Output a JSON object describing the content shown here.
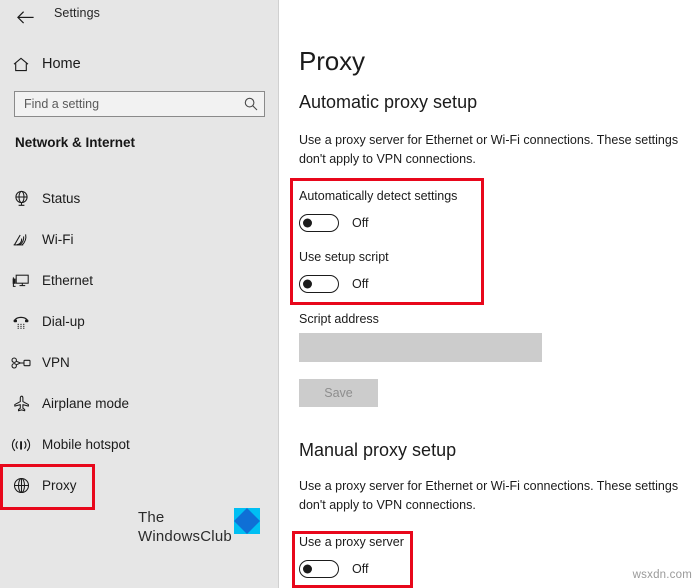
{
  "window": {
    "title": "Settings",
    "back_icon": "back-arrow-icon"
  },
  "sidebar": {
    "home": {
      "label": "Home",
      "icon": "home-icon"
    },
    "search": {
      "value": "",
      "placeholder": "Find a setting",
      "icon": "search-icon"
    },
    "category_heading": "Network & Internet",
    "items": [
      {
        "label": "Status",
        "icon": "status-globe-icon",
        "selected": false
      },
      {
        "label": "Wi-Fi",
        "icon": "wifi-icon",
        "selected": false
      },
      {
        "label": "Ethernet",
        "icon": "ethernet-icon",
        "selected": false
      },
      {
        "label": "Dial-up",
        "icon": "dialup-phone-icon",
        "selected": false
      },
      {
        "label": "VPN",
        "icon": "vpn-icon",
        "selected": false
      },
      {
        "label": "Airplane mode",
        "icon": "airplane-icon",
        "selected": false
      },
      {
        "label": "Mobile hotspot",
        "icon": "mobile-hotspot-icon",
        "selected": false
      },
      {
        "label": "Proxy",
        "icon": "proxy-globe-icon",
        "selected": true
      }
    ],
    "logo": {
      "line1": "The",
      "line2": "WindowsClub",
      "mark_icon": "windowsclub-diamond-icon"
    }
  },
  "main": {
    "page_title": "Proxy",
    "automatic": {
      "heading": "Automatic proxy setup",
      "description": "Use a proxy server for Ethernet or Wi-Fi connections. These settings don't apply to VPN connections.",
      "auto_detect": {
        "label": "Automatically detect settings",
        "state": "Off"
      },
      "setup_script": {
        "label": "Use setup script",
        "state": "Off"
      },
      "script_address": {
        "label": "Script address",
        "value": "",
        "placeholder": ""
      },
      "save_label": "Save"
    },
    "manual": {
      "heading": "Manual proxy setup",
      "description": "Use a proxy server for Ethernet or Wi-Fi connections. These settings don't apply to VPN connections.",
      "use_proxy": {
        "label": "Use a proxy server",
        "state": "Off"
      }
    }
  },
  "annotations": {
    "highlight_color": "#e8071b"
  },
  "watermark": "wsxdn.com"
}
